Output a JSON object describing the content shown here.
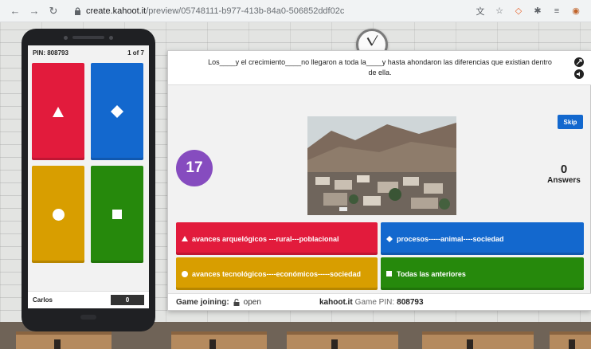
{
  "browser": {
    "url_host": "create.kahoot.it",
    "url_path": "/preview/05748111-b977-413b-84a0-506852ddf02c",
    "icons": [
      "back-arrow-icon",
      "forward-arrow-icon",
      "reload-icon",
      "lock-icon",
      "translate-icon",
      "star-icon",
      "extension-icon",
      "puzzle-icon",
      "playlist-icon",
      "profile-icon"
    ]
  },
  "phone": {
    "pin_label": "PIN: 808793",
    "progress": "1 of 7",
    "player_name": "Carlos",
    "score": "0",
    "tiles": [
      {
        "color": "#e21b3c",
        "shape": "triangle"
      },
      {
        "color": "#1368ce",
        "shape": "diamond"
      },
      {
        "color": "#d89e00",
        "shape": "circle"
      },
      {
        "color": "#26890c",
        "shape": "square"
      }
    ]
  },
  "question": {
    "text": "Los____y el crecimiento____no llegaron a toda la____y hasta ahondaron las diferencias que existian dentro de ella."
  },
  "skip_label": "Skip",
  "timer": "17",
  "answers_count": {
    "value": "0",
    "label": "Answers"
  },
  "answers": [
    {
      "text": "avances arquelógicos ---rural---poblacional",
      "color": "#e21b3c",
      "shape": "triangle"
    },
    {
      "text": "procesos-----animal----sociedad",
      "color": "#1368ce",
      "shape": "diamond"
    },
    {
      "text": "avances tecnológicos----económicos-----sociedad",
      "color": "#d89e00",
      "shape": "circle"
    },
    {
      "text": "Todas las anteriores",
      "color": "#26890c",
      "shape": "square"
    }
  ],
  "footer": {
    "joining_label": "Game joining:",
    "joining_state": "open",
    "brand": "kahoot.it",
    "game_pin_label": "Game PIN:",
    "game_pin": "808793"
  }
}
